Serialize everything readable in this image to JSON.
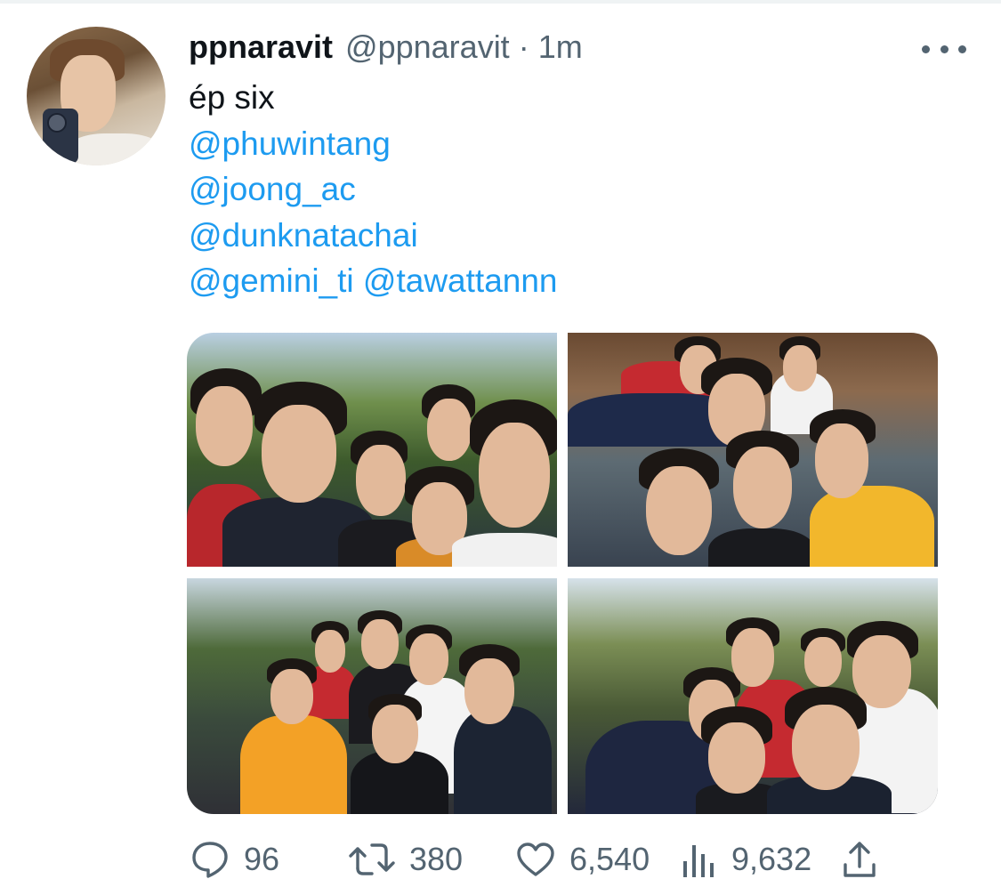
{
  "tweet": {
    "display_name": "ppnaravit",
    "handle": "@ppnaravit",
    "separator": "·",
    "time": "1m",
    "text_line": "ép six",
    "mentions": [
      "@phuwintang",
      "@joong_ac",
      "@dunknatachai",
      "@gemini_ti",
      "@tawattannn"
    ]
  },
  "media": {
    "photos": [
      {
        "label": "photo-1"
      },
      {
        "label": "photo-2"
      },
      {
        "label": "photo-3"
      },
      {
        "label": "photo-4"
      }
    ]
  },
  "actions": {
    "reply_count": "96",
    "retweet_count": "380",
    "like_count": "6,540",
    "views_count": "9,632"
  },
  "icons": {
    "more": "more-horizontal-icon",
    "reply": "reply-bubble-icon",
    "retweet": "retweet-icon",
    "like": "heart-icon",
    "views": "views-bar-chart-icon",
    "share": "share-upload-icon"
  },
  "colors": {
    "text_primary": "#0f1419",
    "text_secondary": "#536471",
    "link": "#1d9bf0"
  }
}
